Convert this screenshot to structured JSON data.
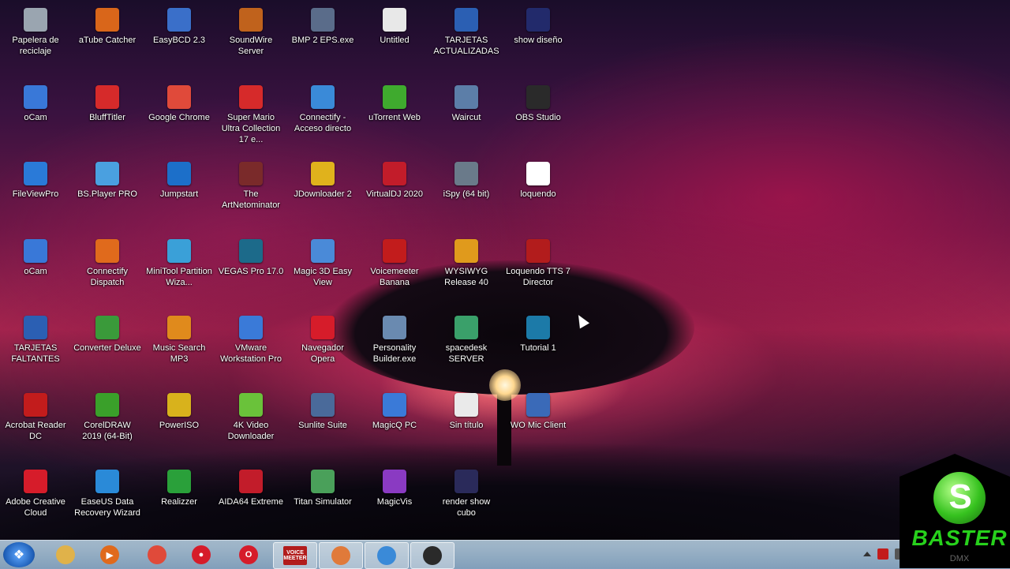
{
  "desktop": {
    "icons": [
      {
        "label": "Papelera de reciclaje",
        "icon": "recycle-bin-icon",
        "color": "#9aa5b0"
      },
      {
        "label": "aTube Catcher",
        "icon": "atube-catcher-icon",
        "color": "#d9661a"
      },
      {
        "label": "EasyBCD 2.3",
        "icon": "easybcd-icon",
        "color": "#3a6fc9"
      },
      {
        "label": "SoundWire Server",
        "icon": "soundwire-icon",
        "color": "#c0621c"
      },
      {
        "label": "BMP 2 EPS.exe",
        "icon": "exe-file-icon",
        "color": "#5a6c8a"
      },
      {
        "label": "Untitled",
        "icon": "document-icon",
        "color": "#e8e8e8"
      },
      {
        "label": "TARJETAS ACTUALIZADAS",
        "icon": "word-document-icon",
        "color": "#2b5fb3"
      },
      {
        "label": "show diseño",
        "icon": "video-file-icon",
        "color": "#222a6b"
      },
      {
        "label": "oCam",
        "icon": "ocam-icon",
        "color": "#3978d8"
      },
      {
        "label": "BluffTitler",
        "icon": "blufftitler-icon",
        "color": "#d62a2a"
      },
      {
        "label": "Google Chrome",
        "icon": "chrome-icon",
        "color": "#e04a3a"
      },
      {
        "label": "Super Mario Ultra Collection 17 e...",
        "icon": "mario-icon",
        "color": "#d62a2a"
      },
      {
        "label": "Connectify - Acceso directo",
        "icon": "connectify-icon",
        "color": "#3a8ad8"
      },
      {
        "label": "uTorrent Web",
        "icon": "utorrent-icon",
        "color": "#3faa2e"
      },
      {
        "label": "Waircut",
        "icon": "waircut-icon",
        "color": "#5c7ea8"
      },
      {
        "label": "OBS Studio",
        "icon": "obs-icon",
        "color": "#2a2a2a"
      },
      {
        "label": "FileViewPro",
        "icon": "fileviewpro-icon",
        "color": "#2a7ad8"
      },
      {
        "label": "BS.Player PRO",
        "icon": "bsplayer-icon",
        "color": "#4aa0e0"
      },
      {
        "label": "Jumpstart",
        "icon": "jumpstart-icon",
        "color": "#1c6fc9"
      },
      {
        "label": "The ArtNetominator",
        "icon": "artnetominator-icon",
        "color": "#7a2a2a"
      },
      {
        "label": "JDownloader 2",
        "icon": "jdownloader-icon",
        "color": "#e0b21c"
      },
      {
        "label": "VirtualDJ 2020",
        "icon": "virtualdj-icon",
        "color": "#c21c2a"
      },
      {
        "label": "iSpy (64 bit)",
        "icon": "ispy-icon",
        "color": "#6a7a8a"
      },
      {
        "label": "loquendo",
        "icon": "blank-file-icon",
        "color": "#ffffff"
      },
      {
        "label": "oCam",
        "icon": "ocam-icon",
        "color": "#3978d8"
      },
      {
        "label": "Connectify Dispatch",
        "icon": "connectify-dispatch-icon",
        "color": "#e06a1c"
      },
      {
        "label": "MiniTool Partition Wiza...",
        "icon": "minitool-icon",
        "color": "#3aa0d8"
      },
      {
        "label": "VEGAS Pro 17.0",
        "icon": "vegas-icon",
        "color": "#1c6a8a"
      },
      {
        "label": "Magic 3D Easy View",
        "icon": "magic3d-icon",
        "color": "#4a8ad8"
      },
      {
        "label": "Voicemeeter Banana",
        "icon": "voicemeeter-icon",
        "color": "#c21c1c"
      },
      {
        "label": "WYSIWYG Release 40",
        "icon": "wysiwyg-icon",
        "color": "#e09a1c"
      },
      {
        "label": "Loquendo TTS 7 Director",
        "icon": "loquendo-icon",
        "color": "#b21c1c"
      },
      {
        "label": "TARJETAS FALTANTES",
        "icon": "word-document-icon",
        "color": "#2b5fb3"
      },
      {
        "label": "Converter Deluxe",
        "icon": "converter-icon",
        "color": "#3a9a3a"
      },
      {
        "label": "Music Search MP3",
        "icon": "music-search-icon",
        "color": "#e08a1c"
      },
      {
        "label": "VMware Workstation Pro",
        "icon": "vmware-icon",
        "color": "#3a7ad8"
      },
      {
        "label": "Navegador Opera",
        "icon": "opera-icon",
        "color": "#d61c2a"
      },
      {
        "label": "Personality Builder.exe",
        "icon": "exe-file-icon",
        "color": "#6a8ab0"
      },
      {
        "label": "spacedesk SERVER",
        "icon": "spacedesk-icon",
        "color": "#3aa06a"
      },
      {
        "label": "Tutorial 1",
        "icon": "vegas-project-icon",
        "color": "#1c7aa8"
      },
      {
        "label": "Acrobat Reader DC",
        "icon": "acrobat-icon",
        "color": "#c21c1c"
      },
      {
        "label": "CorelDRAW 2019 (64-Bit)",
        "icon": "coreldraw-icon",
        "color": "#3aa02a"
      },
      {
        "label": "PowerISO",
        "icon": "poweriso-icon",
        "color": "#d8b21c"
      },
      {
        "label": "4K Video Downloader",
        "icon": "4k-video-icon",
        "color": "#6ac23a"
      },
      {
        "label": "Sunlite Suite",
        "icon": "sunlite-icon",
        "color": "#4a6a9a"
      },
      {
        "label": "MagicQ PC",
        "icon": "magicq-icon",
        "color": "#3a7ad8"
      },
      {
        "label": "Sin título",
        "icon": "image-file-icon",
        "color": "#eaeaea"
      },
      {
        "label": "WO Mic Client",
        "icon": "wo-mic-icon",
        "color": "#3a6ab8"
      },
      {
        "label": "Adobe Creative Cloud",
        "icon": "creative-cloud-icon",
        "color": "#d61c2a"
      },
      {
        "label": "EaseUS Data Recovery Wizard",
        "icon": "easeus-icon",
        "color": "#2a8ad8"
      },
      {
        "label": "Realizzer",
        "icon": "realizzer-icon",
        "color": "#2aa03a"
      },
      {
        "label": "AIDA64 Extreme",
        "icon": "aida64-icon",
        "color": "#c21c2a"
      },
      {
        "label": "Titan Simulator",
        "icon": "titan-icon",
        "color": "#4aa05a"
      },
      {
        "label": "MagicVis",
        "icon": "magicvis-icon",
        "color": "#8a3ac2"
      },
      {
        "label": "render show cubo",
        "icon": "video-file-icon",
        "color": "#2a2a5a"
      }
    ]
  },
  "taskbar": {
    "start": {
      "icon": "windows-start-icon"
    },
    "pinned": [
      {
        "icon": "file-explorer-icon",
        "color": "#e0b24a",
        "glyph": ""
      },
      {
        "icon": "media-player-icon",
        "color": "#e06a1c",
        "glyph": "▶"
      },
      {
        "icon": "chrome-icon",
        "color": "#e04a3a",
        "glyph": ""
      },
      {
        "icon": "screen-recorder-icon",
        "color": "#d61c2a",
        "glyph": "●"
      },
      {
        "icon": "opera-icon",
        "color": "#d61c2a",
        "glyph": "O"
      },
      {
        "icon": "voicemeeter-icon",
        "color": "#b21c1c",
        "glyph": ""
      },
      {
        "icon": "microphone-icon",
        "color": "#e07a3a",
        "glyph": ""
      },
      {
        "icon": "connectify-icon",
        "color": "#3a8ad8",
        "glyph": ""
      },
      {
        "icon": "obs-icon",
        "color": "#2a2a2a",
        "glyph": ""
      }
    ],
    "voicemeeter_label": [
      "VOICE",
      "MEETER"
    ],
    "tray": [
      "show-hidden-icons-icon",
      "network-error-icon",
      "device-icon",
      "signal-icon"
    ]
  },
  "watermark": {
    "title": "BASTER",
    "subtitle": "DMX",
    "logo": "baster-s-logo-icon"
  }
}
